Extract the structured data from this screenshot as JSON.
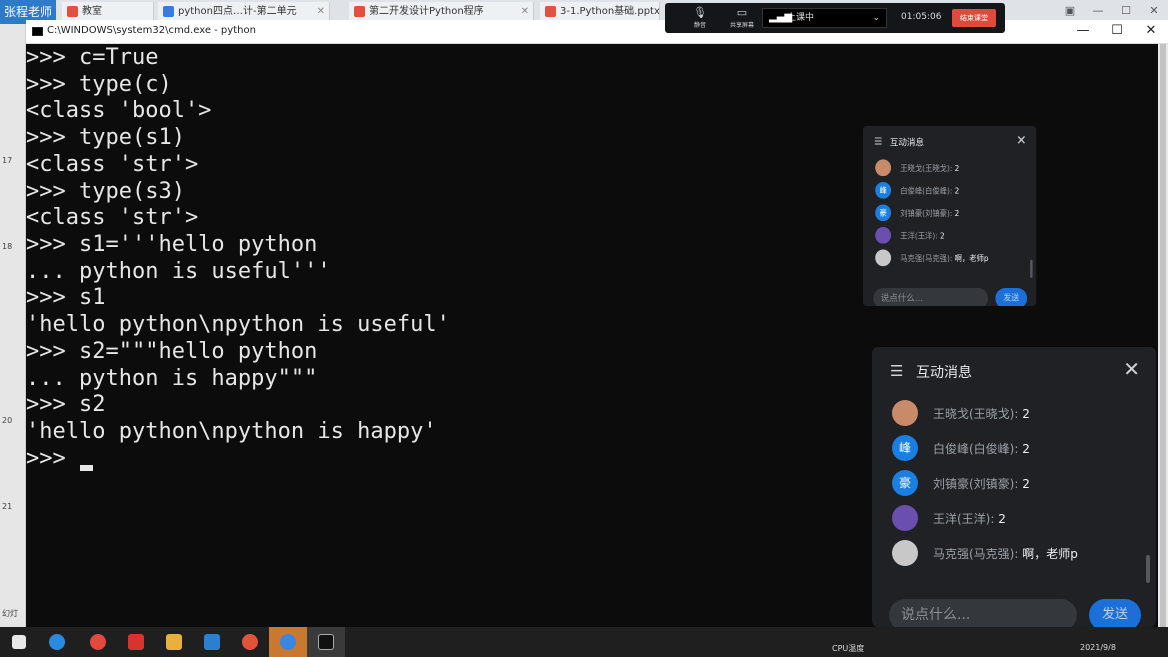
{
  "browser": {
    "corner_label": "张程老师",
    "tabs": [
      {
        "label": "教室",
        "color": "#e0513e"
      },
      {
        "label": "python四点…计-第二单元",
        "color": "#3a7be0"
      },
      {
        "label": "第二开发设计Python程序",
        "color": "#e0513e"
      },
      {
        "label": "3-1.Python基础.pptx",
        "color": "#e0513e"
      }
    ],
    "window_controls": [
      "▣",
      "—",
      "☐",
      "✕"
    ]
  },
  "meeting": {
    "mic_label": "静音",
    "share_label": "共享屏幕",
    "mode_value": "上课中",
    "timer": "01:05:06",
    "end_label": "结束课堂"
  },
  "ppt_strip": {
    "slide_numbers": [
      "17",
      "18",
      "20",
      "21"
    ],
    "bottom_label": "幻灯"
  },
  "cmd": {
    "title": "C:\\WINDOWS\\system32\\cmd.exe - python",
    "controls": [
      "—",
      "☐",
      "✕"
    ],
    "lines": [
      ">>> c=True",
      ">>> type(c)",
      "<class 'bool'>",
      ">>> type(s1)",
      "<class 'str'>",
      ">>> type(s3)",
      "<class 'str'>",
      ">>> s1='''hello python",
      "... python is useful'''",
      ">>> s1",
      "'hello python\\npython is useful'",
      ">>> s2=\"\"\"hello python",
      "... python is happy\"\"\"",
      ">>> s2",
      "'hello python\\npython is happy'",
      ">>> "
    ]
  },
  "chat": {
    "title": "互动消息",
    "messages": [
      {
        "name": "王晓戈(王晓戈):",
        "text": "2",
        "avatar_color": "#c98a6a",
        "avatar_glyph": ""
      },
      {
        "name": "白俊峰(白俊峰):",
        "text": "2",
        "avatar_color": "#1a7fe0",
        "avatar_glyph": "峰"
      },
      {
        "name": "刘镇豪(刘镇豪):",
        "text": "2",
        "avatar_color": "#1a7fe0",
        "avatar_glyph": "豪"
      },
      {
        "name": "王洋(王洋):",
        "text": "2",
        "avatar_color": "#6a4fb0",
        "avatar_glyph": ""
      },
      {
        "name": "马克强(马克强):",
        "text": "啊，老师p",
        "avatar_color": "#c8c8c8",
        "avatar_glyph": ""
      }
    ],
    "input_placeholder": "说点什么...",
    "send_label": "发送"
  },
  "taskbar": {
    "apps": [
      "start",
      "ie",
      "chrome",
      "wps",
      "explorer",
      "vscode",
      "recorder",
      "feishu",
      "cmd"
    ],
    "cpu_label": "CPU温度",
    "date": "2021/9/8"
  }
}
